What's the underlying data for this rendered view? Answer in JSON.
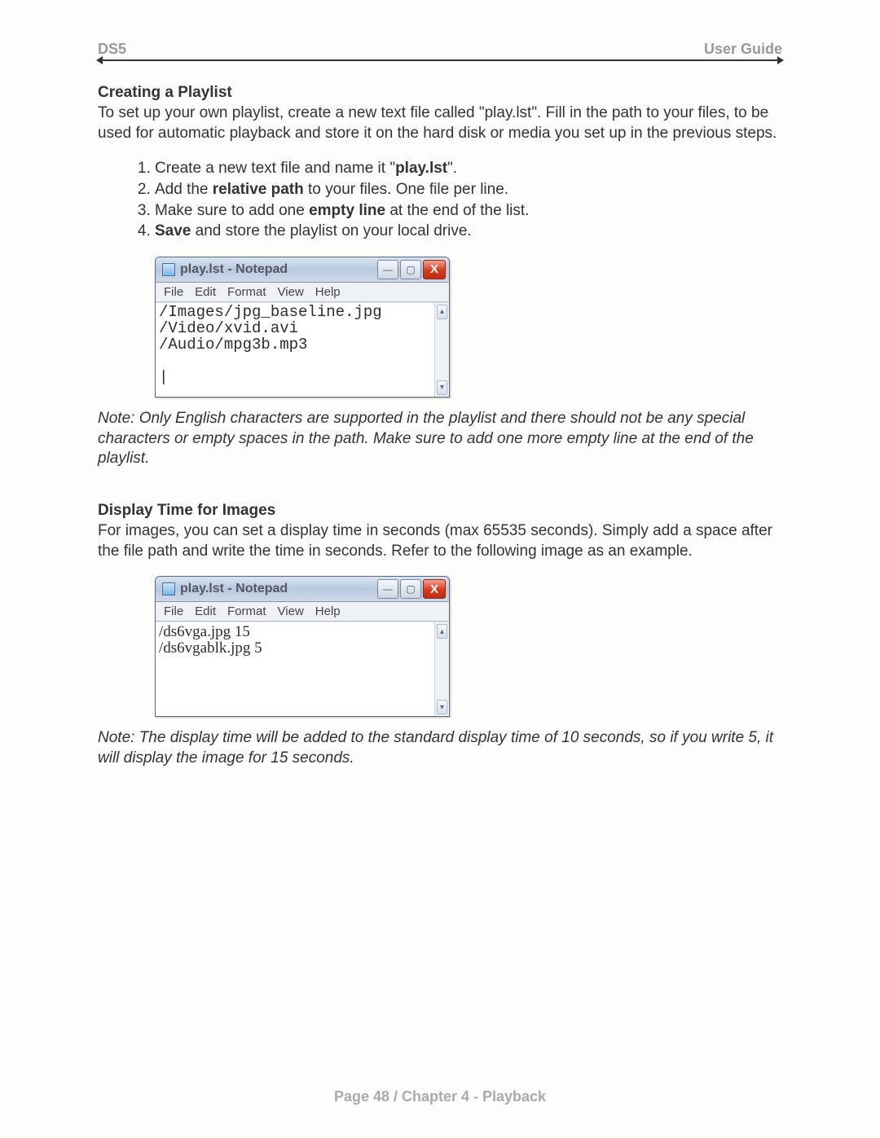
{
  "header": {
    "left": "DS5",
    "right": "User Guide"
  },
  "section1": {
    "title": "Creating a Playlist",
    "intro": "To set up your own playlist, create a new text file called \"play.lst\". Fill in the path to your files, to be used for automatic playback and store it on the hard disk or media you set up in the previous steps.",
    "steps": {
      "s1_a": "Create a new text file and name it \"",
      "s1_b": "play.lst",
      "s1_c": "\".",
      "s2_a": "Add the ",
      "s2_b": "relative path",
      "s2_c": " to your files. One file per line.",
      "s3_a": "Make sure to add one ",
      "s3_b": "empty line",
      "s3_c": " at the end of the list.",
      "s4_a": "Save",
      "s4_b": " and store the playlist on your local drive."
    },
    "note": "Note: Only English characters are supported in the playlist and there should not be any special characters or empty spaces in the path. Make sure to add one more empty line at the end of the playlist."
  },
  "section2": {
    "title": "Display Time for Images",
    "intro": "For images, you can set a display time in seconds (max 65535 seconds). Simply add a space after the file path and write the time in seconds. Refer to the following image as an example.",
    "note": "Note: The display time will be added to the standard display time of 10 seconds, so if you write 5, it will display the image for 15 seconds."
  },
  "notepad": {
    "title": "play.lst - Notepad",
    "menu": {
      "file": "File",
      "edit": "Edit",
      "format": "Format",
      "view": "View",
      "help": "Help"
    },
    "content1_line1": "/Images/jpg_baseline.jpg",
    "content1_line2": "/Video/xvid.avi",
    "content1_line3": "/Audio/mpg3b.mp3",
    "content1_cursor": "|",
    "content2_line1": "/ds6vga.jpg 15",
    "content2_line2": "/ds6vgablk.jpg 5"
  },
  "footer": "Page 48  /  Chapter 4 - Playback"
}
